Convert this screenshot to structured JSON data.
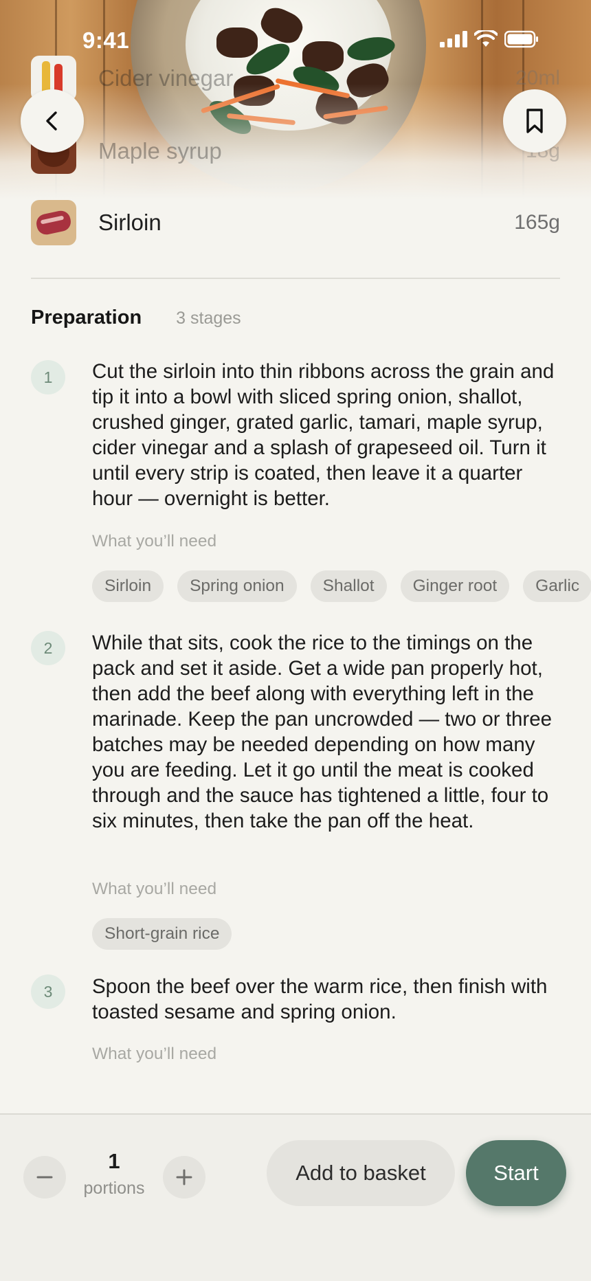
{
  "status_bar": {
    "time": "9:41"
  },
  "nav": {
    "back_icon": "chevron-left-icon",
    "bookmark_icon": "bookmark-icon"
  },
  "ingredients": [
    {
      "name": "Cider vinegar",
      "quantity": "20ml"
    },
    {
      "name": "Maple syrup",
      "quantity": "18g"
    },
    {
      "name": "Sirloin",
      "quantity": "165g"
    }
  ],
  "preparation": {
    "title": "Preparation",
    "stage_count": "3 stages",
    "need_label": "What you’ll need",
    "steps": [
      {
        "number": "1",
        "text": "Cut the sirloin into thin ribbons across the grain and tip it into a bowl with sliced spring onion, shallot, crushed ginger, grated garlic, tamari, maple syrup, cider vinegar and a splash of grapeseed oil. Turn it until every strip is coated, then leave it a quarter hour — overnight is better.",
        "needs": [
          "Sirloin",
          "Spring onion",
          "Shallot",
          "Ginger root",
          "Garlic"
        ]
      },
      {
        "number": "2",
        "text": "While that sits, cook the rice to the timings on the pack and set it aside. Get a wide pan properly hot, then add the beef along with everything left in the marinade. Keep the pan uncrowded — two or three batches may be needed depending on how many you are feeding. Let it go until the meat is cooked through and the sauce has tightened a little, four to six minutes, then take the pan off the heat.",
        "needs": [
          "Short-grain rice"
        ]
      },
      {
        "number": "3",
        "text": "Spoon the beef over the warm rice, then finish with toasted sesame and spring onion.",
        "needs": []
      }
    ]
  },
  "footer": {
    "portions_value": "1",
    "portions_label": "portions",
    "add_basket_label": "Add to basket",
    "start_label": "Start"
  },
  "colors": {
    "accent": "#55786a",
    "step_badge": "#e2ebe4",
    "chip_bg": "#e4e3de"
  }
}
